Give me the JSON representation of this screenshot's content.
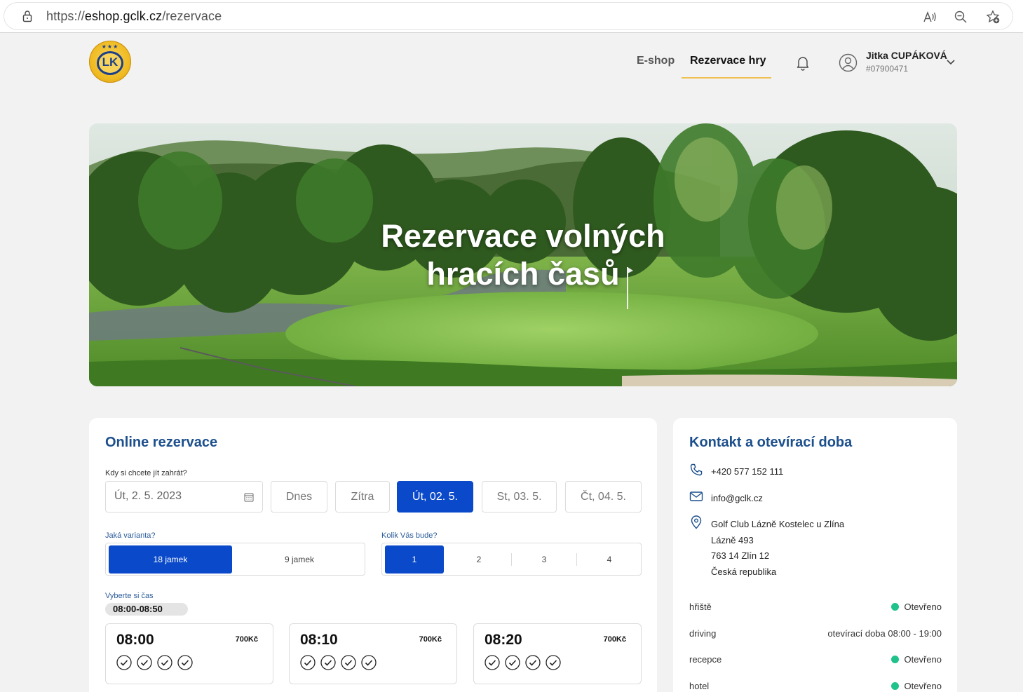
{
  "browser": {
    "url_prefix": "https://",
    "url_host": "eshop.gclk.cz",
    "url_path": "/rezervace"
  },
  "header": {
    "logo_text": "LK",
    "nav": [
      {
        "label": "E-shop",
        "active": false
      },
      {
        "label": "Rezervace hry",
        "active": true
      }
    ],
    "user": {
      "name": "Jitka CUPÁKOVÁ",
      "id": "#07900471"
    }
  },
  "hero": {
    "title_line1": "Rezervace volných",
    "title_line2": "hracích časů"
  },
  "booking": {
    "title": "Online rezervace",
    "date_label": "Kdy si chcete jít zahrát?",
    "date_value": "Út, 2. 5. 2023",
    "quick_dates": [
      {
        "label": "Dnes",
        "active": false
      },
      {
        "label": "Zítra",
        "active": false
      },
      {
        "label": "Út, 02. 5.",
        "active": true
      },
      {
        "label": "St, 03. 5.",
        "active": false
      },
      {
        "label": "Čt, 04. 5.",
        "active": false
      }
    ],
    "variant_label": "Jaká varianta?",
    "variants": [
      {
        "label": "18 jamek",
        "active": true
      },
      {
        "label": "9 jamek",
        "active": false
      }
    ],
    "players_label": "Kolik Vás bude?",
    "players": [
      {
        "label": "1",
        "active": true
      },
      {
        "label": "2",
        "active": false
      },
      {
        "label": "3",
        "active": false
      },
      {
        "label": "4",
        "active": false
      }
    ],
    "time_label": "Vyberte si čas",
    "time_range": "08:00-08:50",
    "slots": [
      {
        "time": "08:00",
        "price": "700Kč",
        "free_spots": 4
      },
      {
        "time": "08:10",
        "price": "700Kč",
        "free_spots": 4
      },
      {
        "time": "08:20",
        "price": "700Kč",
        "free_spots": 4
      }
    ]
  },
  "contact": {
    "title": "Kontakt a otevírací doba",
    "phone": "+420 577 152 111",
    "email": "info@gclk.cz",
    "address": [
      "Golf Club Lázně Kostelec u Zlína",
      "Lázně 493",
      "763 14 Zlín 12",
      "Česká republika"
    ],
    "hours": [
      {
        "name": "hřiště",
        "value": "Otevřeno",
        "status": "open"
      },
      {
        "name": "driving",
        "value": "otevírací doba 08:00 - 19:00",
        "status": "hours"
      },
      {
        "name": "recepce",
        "value": "Otevřeno",
        "status": "open"
      },
      {
        "name": "hotel",
        "value": "Otevřeno",
        "status": "open"
      }
    ]
  },
  "colors": {
    "primary": "#0a49c9",
    "title_blue": "#1c4f8c",
    "open_green": "#1fc28a",
    "nav_underline": "#f0c050"
  }
}
